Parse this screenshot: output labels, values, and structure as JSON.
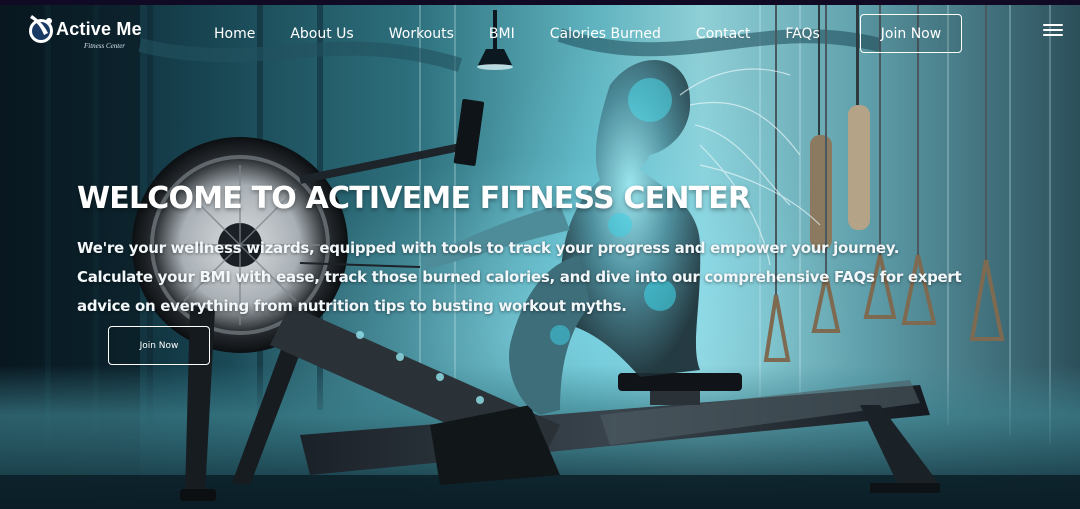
{
  "brand": {
    "name": "Active Me",
    "tagline": "Fitness Center"
  },
  "nav": {
    "links": [
      "Home",
      "About Us",
      "Workouts",
      "BMI",
      "Calories Burned",
      "Contact",
      "FAQs"
    ],
    "cta_label": "Join Now",
    "menu_icon": "hamburger-icon"
  },
  "hero": {
    "title": "WELCOME TO ACTIVEME FITNESS CENTER",
    "text": "We're your wellness wizards, equipped with tools to track your progress and empower your journey. Calculate your BMI with ease, track those burned calories, and dive into our comprehensive FAQs for expert advice on everything from nutrition tips to busting workout myths.",
    "cta_label": "Join Now"
  },
  "colors": {
    "top_strip": "#100a24",
    "text": "#ffffff",
    "accent_cyan": "#5fd6e6"
  }
}
